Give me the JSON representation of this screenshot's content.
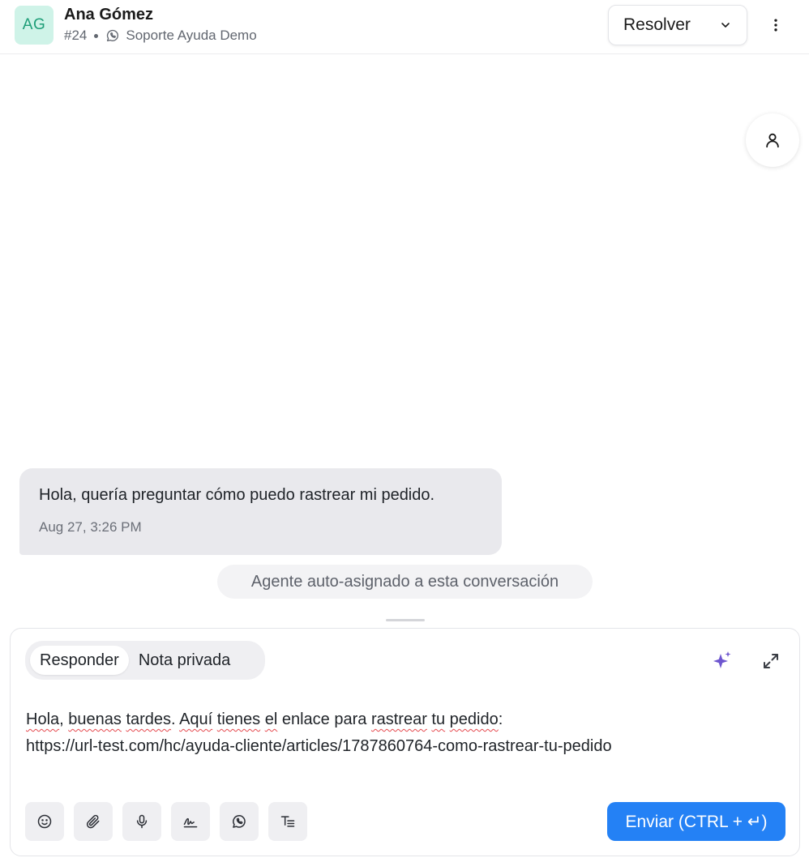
{
  "header": {
    "avatar_initials": "AG",
    "contact_name": "Ana Gómez",
    "conversation_id": "#24",
    "inbox_name": "Soporte Ayuda Demo",
    "resolve_label": "Resolver"
  },
  "messages": [
    {
      "text": "Hola, quería preguntar cómo puedo rastrear mi pedido.",
      "time": "Aug 27, 3:26 PM"
    }
  ],
  "activity": {
    "text": "Agente auto-asignado a esta conversación"
  },
  "composer": {
    "tabs": [
      {
        "label": "Responder",
        "active": true
      },
      {
        "label": "Nota privada",
        "active": false
      }
    ],
    "draft": {
      "words": [
        "Hola",
        "buenas",
        "tardes",
        "Aquí",
        "tienes",
        "el",
        "enlace",
        "para",
        "rastrear",
        "tu",
        "pedido"
      ],
      "url": "https://url-test.com/hc/ayuda-cliente/articles/1787860764-como-rastrear-tu-pedido"
    },
    "send_label": "Enviar (CTRL + ↵)"
  },
  "colors": {
    "accent": "#2481f5",
    "avatar_bg": "#cff3e8",
    "avatar_text": "#1e9e78",
    "sparkle": "#6e56cf"
  }
}
